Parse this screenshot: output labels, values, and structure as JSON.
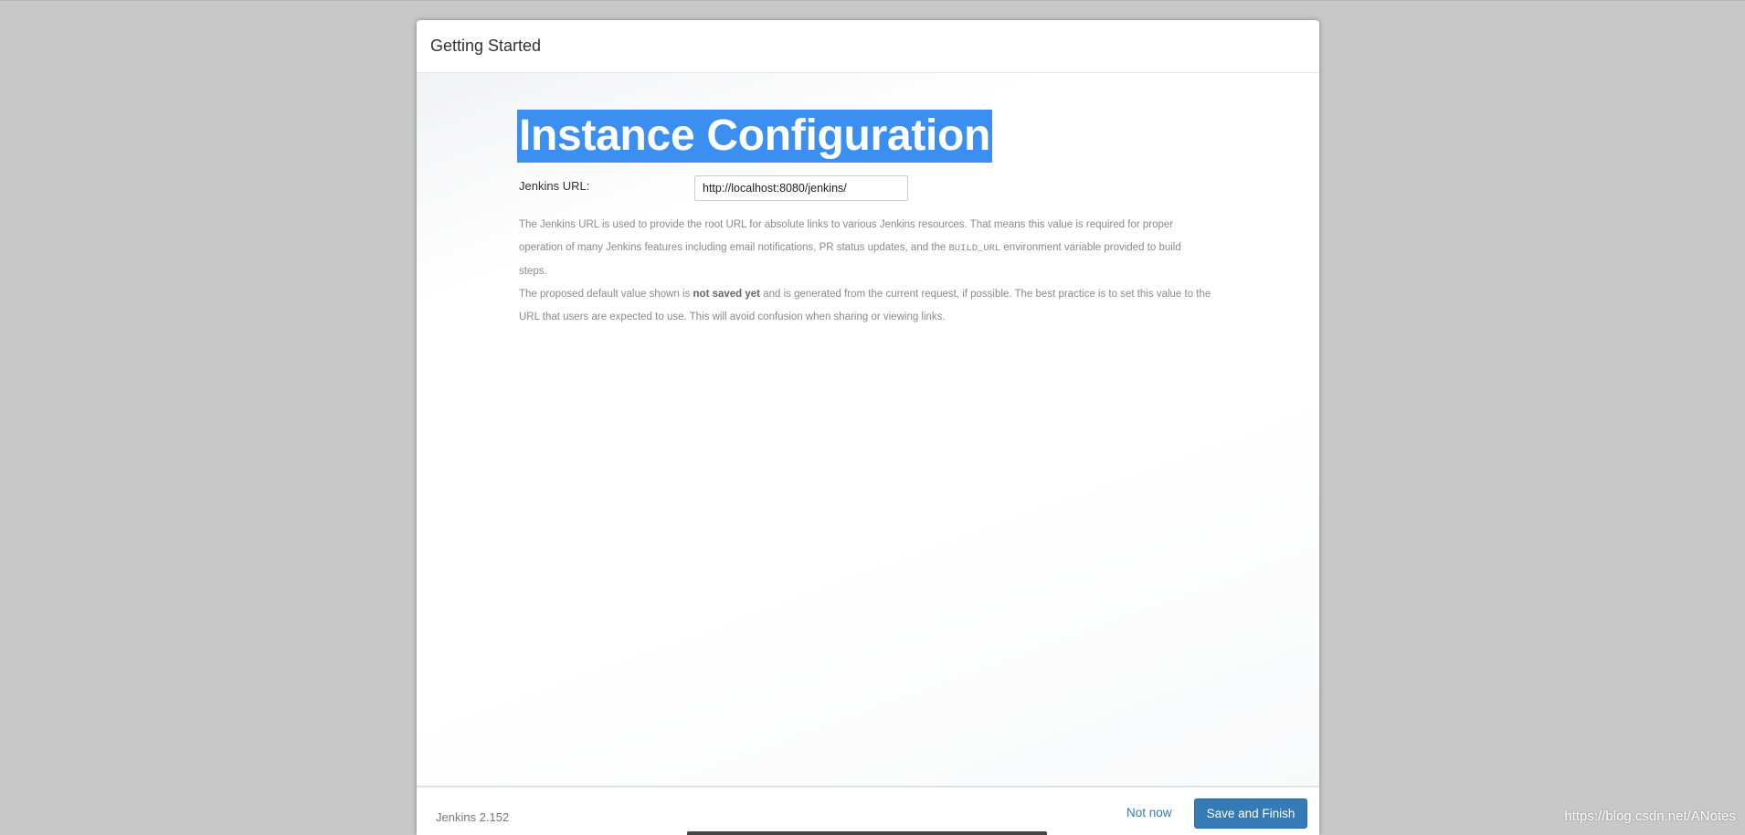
{
  "dialog": {
    "title": "Getting Started"
  },
  "main": {
    "heading": "Instance Configuration",
    "url_label": "Jenkins URL:",
    "url_value": "http://localhost:8080/jenkins/",
    "help_p1_a": "The Jenkins URL is used to provide the root URL for absolute links to various Jenkins resources. That means this value is required for proper operation of many Jenkins features including email notifications, PR status updates, and the ",
    "help_p1_code": "BUILD_URL",
    "help_p1_b": " environment variable provided to build steps.",
    "help_p2_a": "The proposed default value shown is ",
    "help_p2_bold": "not saved yet",
    "help_p2_b": " and is generated from the current request, if possible. The best practice is to set this value to the URL that users are expected to use. This will avoid confusion when sharing or viewing links."
  },
  "footer": {
    "version": "Jenkins 2.152",
    "not_now_label": "Not now",
    "save_label": "Save and Finish"
  },
  "watermark": "https://blog.csdn.net/ANotes",
  "colors": {
    "backdrop": "#c8c8c8",
    "heading_highlight": "#3b8ff0",
    "primary_button": "#337ab7",
    "link": "#337ab7"
  }
}
